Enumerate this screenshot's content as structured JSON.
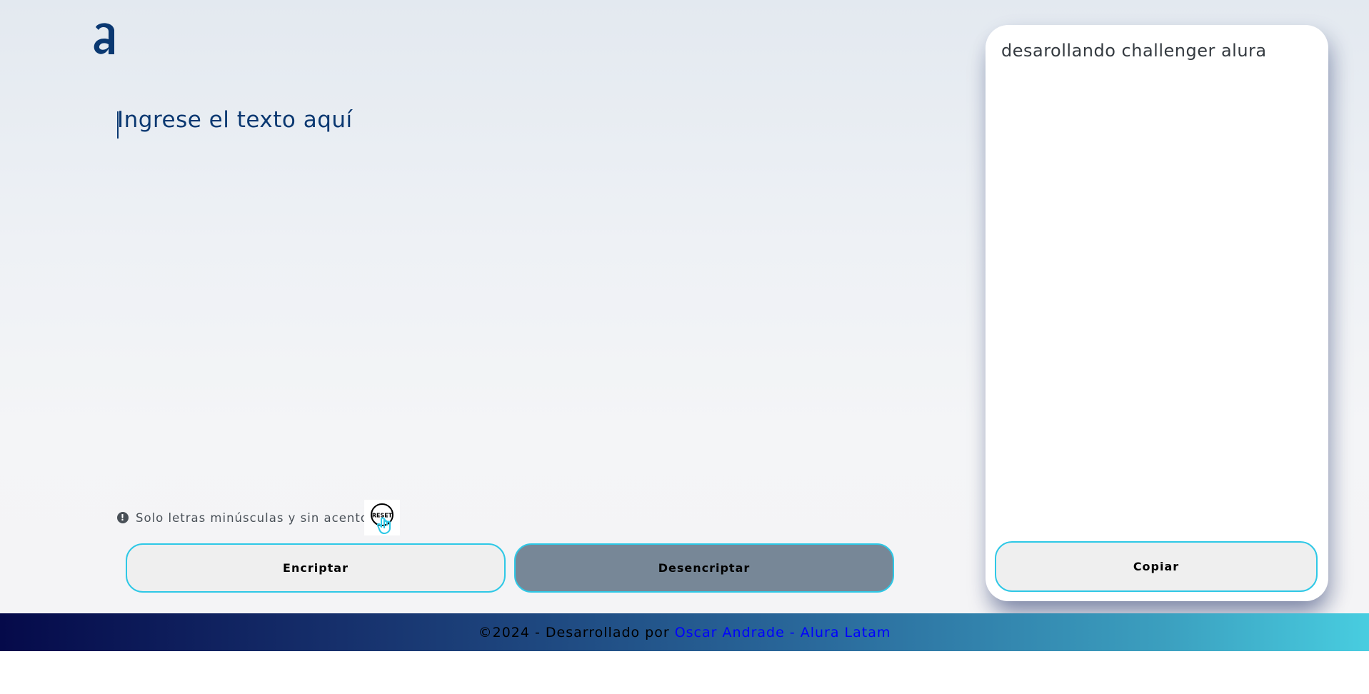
{
  "brand": {
    "logo_icon": "alura-a-logo-icon",
    "logo_color": "#0a3871"
  },
  "editor": {
    "placeholder": "Ingrese el texto aquí",
    "value": ""
  },
  "hint": {
    "icon": "exclamation-circle-icon",
    "text": "Solo letras minúsculas y sin acentos"
  },
  "reset": {
    "label": "RESET",
    "icon": "reset-hand-pointer-icon"
  },
  "actions": {
    "encrypt_label": "Encriptar",
    "decrypt_label": "Desencriptar"
  },
  "output": {
    "text": "desarollando challenger alura",
    "copy_label": "Copiar"
  },
  "footer": {
    "prefix": "©2024 - Desarrollado por",
    "link_text": "Oscar Andrade - Alura Latam"
  },
  "colors": {
    "accent_border": "#2ec8e6",
    "primary_text": "#0a3871",
    "decrypt_bg": "#778797",
    "link": "#0000ff"
  }
}
